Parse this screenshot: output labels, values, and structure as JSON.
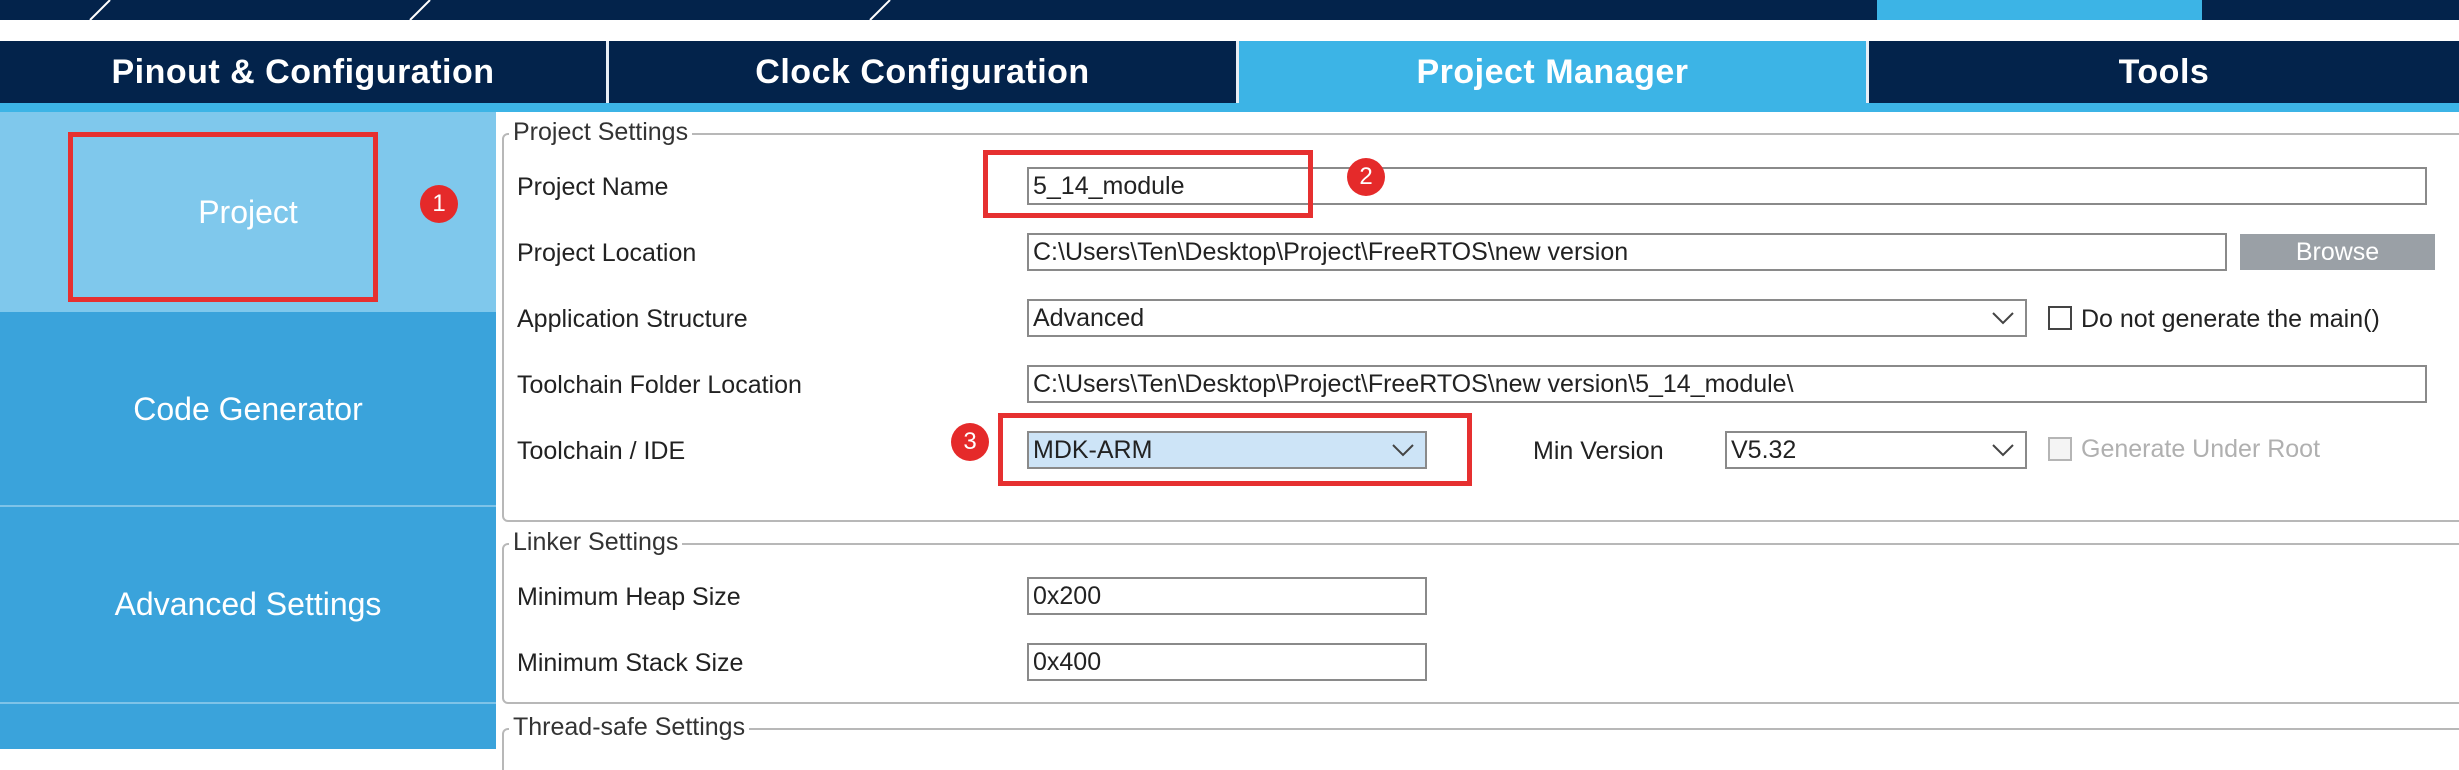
{
  "tabs": [
    {
      "label": "Pinout & Configuration"
    },
    {
      "label": "Clock Configuration"
    },
    {
      "label": "Project Manager"
    },
    {
      "label": "Tools"
    }
  ],
  "sidebar": {
    "items": [
      {
        "label": "Project"
      },
      {
        "label": "Code Generator"
      },
      {
        "label": "Advanced Settings"
      }
    ]
  },
  "annotations": [
    "1",
    "2",
    "3"
  ],
  "project_settings": {
    "legend": "Project Settings",
    "project_name": {
      "label": "Project Name",
      "value": "5_14_module"
    },
    "project_location": {
      "label": "Project Location",
      "value": "C:\\Users\\Ten\\Desktop\\Project\\FreeRTOS\\new version",
      "browse_label": "Browse"
    },
    "application_structure": {
      "label": "Application Structure",
      "value": "Advanced",
      "checkbox_label": "Do not generate the main()"
    },
    "toolchain_folder": {
      "label": "Toolchain Folder Location",
      "value": "C:\\Users\\Ten\\Desktop\\Project\\FreeRTOS\\new version\\5_14_module\\"
    },
    "toolchain_ide": {
      "label": "Toolchain / IDE",
      "value": "MDK-ARM",
      "min_version_label": "Min Version",
      "min_version_value": "V5.32",
      "generate_root_label": "Generate Under Root"
    }
  },
  "linker_settings": {
    "legend": "Linker Settings",
    "heap": {
      "label": "Minimum Heap Size",
      "value": "0x200"
    },
    "stack": {
      "label": "Minimum Stack Size",
      "value": "0x400"
    }
  },
  "thread_safe_settings": {
    "legend": "Thread-safe Settings"
  },
  "colors": {
    "navy": "#03234b",
    "accent": "#3cb4e6",
    "sidebar": "#3aa3db",
    "sidebar_active": "#7fc8ec",
    "annotation_red": "#e63030"
  }
}
